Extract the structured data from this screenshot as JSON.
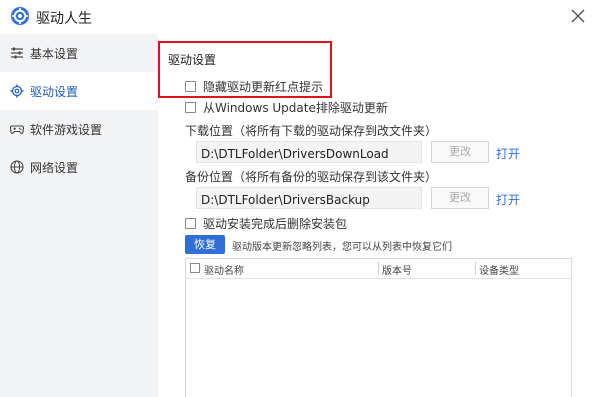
{
  "window": {
    "title": "驱动人生"
  },
  "sidebar": {
    "items": [
      {
        "label": "基本设置",
        "icon": "sliders-icon",
        "active": false
      },
      {
        "label": "驱动设置",
        "icon": "gear-icon",
        "active": true
      },
      {
        "label": "软件游戏设置",
        "icon": "gamepad-icon",
        "active": false
      },
      {
        "label": "网络设置",
        "icon": "globe-icon",
        "active": false
      }
    ]
  },
  "main": {
    "section_title": "驱动设置",
    "options": {
      "hide_red_dot": {
        "label": "隐藏驱动更新红点提示",
        "checked": false
      },
      "exclude_windows_update": {
        "label": "从Windows Update排除驱动更新",
        "checked": false
      },
      "delete_package": {
        "label": "驱动安装完成后删除安装包",
        "checked": false
      }
    },
    "download": {
      "label": "下载位置（将所有下载的驱动保存到改文件夹）",
      "path": "D:\\DTLFolder\\DriversDownLoad",
      "change_label": "更改",
      "open_label": "打开"
    },
    "backup": {
      "label": "备份位置（将所有备份的驱动保存到该文件夹）",
      "path": "D:\\DTLFolder\\DriversBackup",
      "change_label": "更改",
      "open_label": "打开"
    },
    "restore": {
      "button_label": "恢复",
      "hint": "驱动版本更新忽略列表，您可以从列表中恢复它们"
    },
    "table": {
      "columns": [
        "驱动名称",
        "版本号",
        "设备类型"
      ],
      "rows": []
    }
  },
  "colors": {
    "accent": "#2f6fd6",
    "highlight_border": "#d9141b",
    "sidebar_bg": "#f2f3f5",
    "active_nav_text": "#1e5fbf"
  }
}
